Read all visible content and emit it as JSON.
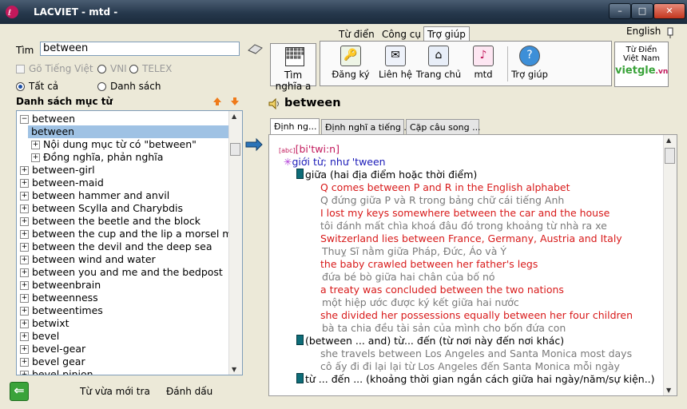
{
  "window": {
    "title": "LACVIET - mtd -",
    "controls": {
      "minimize": "–",
      "maximize": "□",
      "close": "✕"
    }
  },
  "search": {
    "label": "Tìm",
    "value": "between",
    "go_tieng_viet": "Gõ Tiếng Việt",
    "vni": "VNI",
    "telex": "TELEX",
    "all": "Tất cả",
    "list_mode": "Danh sách"
  },
  "entry_list": {
    "title": "Danh sách mục từ",
    "items": [
      {
        "text": "between",
        "marker": "⊟"
      },
      {
        "text": "between",
        "marker": "",
        "selected": true
      },
      {
        "text": "Nội dung mục từ có \"between\"",
        "marker": "⊞"
      },
      {
        "text": "Đồng nghĩa, phản nghĩa",
        "marker": "⊞"
      },
      {
        "text": "between-girl",
        "marker": "⊞"
      },
      {
        "text": "between-maid",
        "marker": "⊞"
      },
      {
        "text": "between hammer and anvil",
        "marker": "⊞"
      },
      {
        "text": "between Scylla and Charybdis",
        "marker": "⊞"
      },
      {
        "text": "between the beetle and the block",
        "marker": "⊞"
      },
      {
        "text": "between the cup and the lip a morsel may",
        "marker": "⊞"
      },
      {
        "text": "between the devil and the deep sea",
        "marker": "⊞"
      },
      {
        "text": "between wind and water",
        "marker": "⊞"
      },
      {
        "text": "between you and me and the bedpost",
        "marker": "⊞"
      },
      {
        "text": "betweenbrain",
        "marker": "⊞"
      },
      {
        "text": "betweenness",
        "marker": "⊞"
      },
      {
        "text": "betweentimes",
        "marker": "⊞"
      },
      {
        "text": "betwixt",
        "marker": "⊞"
      },
      {
        "text": "bevel",
        "marker": "⊞"
      },
      {
        "text": "bevel-gear",
        "marker": "⊞"
      },
      {
        "text": "bevel gear",
        "marker": "⊞"
      },
      {
        "text": "bevel pinion",
        "marker": "⊞"
      }
    ]
  },
  "footer": {
    "recent": "Từ vừa mới tra",
    "bookmark": "Đánh dấu"
  },
  "find_meaning": {
    "label": "Tìm nghĩa a"
  },
  "menu_tabs": {
    "dictionary": "Từ điển",
    "tools": "Công cụ",
    "help": "Trợ giúp",
    "english": "English"
  },
  "tools": [
    {
      "label": "Đăng ký"
    },
    {
      "label": "Liên hệ"
    },
    {
      "label": "Trang chủ"
    },
    {
      "label": "mtd"
    },
    {
      "label": "Trợ giúp"
    }
  ],
  "brand": {
    "line1": "Từ Điển",
    "line2": "Việt Nam",
    "logo": "vietgle",
    "domain": ".vn"
  },
  "entry": {
    "word": "between",
    "tabs": [
      "Định ng...",
      "Định nghĩ a tiếng ...",
      "Cặp câu song ..."
    ],
    "pron_label": "[abc]",
    "pronunciation": "[bi'twi:n]",
    "pos": "giới từ; như 'tween",
    "sense1": "giữa (hai địa điểm hoặc thời điểm)",
    "ex1_en": "Q comes between P and R in the English alphabet",
    "ex1_vi": "Q đứng giữa P và R trong bảng chữ cái tiếng Anh",
    "ex2_en": "I lost my keys somewhere between the car and the house",
    "ex2_vi": "tôi đánh mất chìa khoá đâu đó trong khoảng từ nhà ra xe",
    "ex3_en": "Switzerland lies between France, Germany, Austria and Italy",
    "ex3_vi": "Thuỵ Sĩ nằm giữa Pháp,  Đức, Áo và Ý",
    "ex4_en": "the baby crawled between her father's legs",
    "ex4_vi": "đứa bé bò giữa hai chân của bố nó",
    "ex5_en": "a treaty was concluded between the two nations",
    "ex5_vi": "một hiệp ước được ký kết giữa hai nước",
    "ex6_en": "she divided her possessions equally between her four children",
    "ex6_vi": "bà ta chia đều tài sản của mình cho bốn đứa con",
    "sense2": "(between ... and) từ... đến (từ nơi này đến nơi khác)",
    "ex7_en": "she travels between Los Angeles and Santa Monica most days",
    "ex7_vi": "cô ấy đi đi lại lại từ Los Angeles đến Santa Monica mỗi ngày",
    "sense3": "từ ... đến ... (khoảng thời gian ngắn cách giữa hai ngày/năm/sự kiện..)"
  },
  "colors": {
    "example_en": "#d81a1a",
    "example_vi": "#7a7a7a",
    "pos": "#1a1ab8",
    "selection": "#9fc2e4"
  }
}
